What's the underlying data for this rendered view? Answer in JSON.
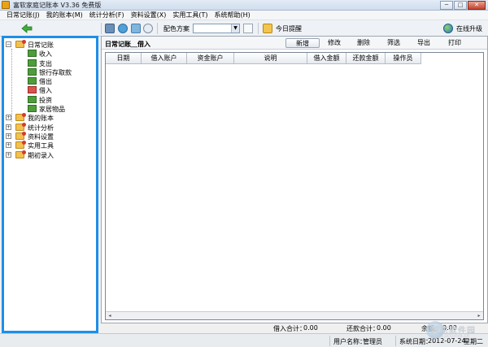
{
  "window": {
    "title": "富软家庭记账本 V3.36  免费版",
    "buttons": {
      "minimize": "─",
      "maximize": "□",
      "close": "✕"
    }
  },
  "menu": {
    "items": [
      {
        "label": "日常记账(J)"
      },
      {
        "label": "我的账本(M)"
      },
      {
        "label": "统计分析(F)"
      },
      {
        "label": "资料设置(X)"
      },
      {
        "label": "实用工具(T)"
      },
      {
        "label": "系统帮助(H)"
      }
    ]
  },
  "toolbar": {
    "color_scheme_label": "配色方案",
    "color_scheme_value": "",
    "combo_arrow": "▼",
    "reminder_label": "今日提醒",
    "upgrade_label": "在线升级"
  },
  "sidebar": {
    "groups": [
      {
        "label": "日常记账",
        "expanded": true,
        "expander": "−",
        "children": [
          {
            "label": "收入",
            "icon": "green"
          },
          {
            "label": "支出",
            "icon": "green"
          },
          {
            "label": "银行存取款",
            "icon": "green"
          },
          {
            "label": "借出",
            "icon": "green"
          },
          {
            "label": "借入",
            "icon": "red"
          },
          {
            "label": "投资",
            "icon": "green"
          },
          {
            "label": "家居物品",
            "icon": "green"
          }
        ]
      },
      {
        "label": "我的账本",
        "expanded": false,
        "expander": "+"
      },
      {
        "label": "统计分析",
        "expanded": false,
        "expander": "+"
      },
      {
        "label": "资料设置",
        "expanded": false,
        "expander": "+"
      },
      {
        "label": "实用工具",
        "expanded": false,
        "expander": "+"
      },
      {
        "label": "期初录入",
        "expanded": false,
        "expander": "+"
      }
    ]
  },
  "main": {
    "title": "日常记账＿借入",
    "actions": {
      "add": "新增",
      "edit": "修改",
      "delete": "删除",
      "filter": "筛选",
      "export": "导出",
      "print": "打印"
    },
    "columns": [
      "日期",
      "借入账户",
      "资金账户",
      "说明",
      "借入金额",
      "还款金额",
      "操作员"
    ],
    "rows": [],
    "scroll_left": "◂",
    "scroll_right": "▸"
  },
  "summary": {
    "borrow_total_label": "借入合计：",
    "borrow_total_value": "0.00",
    "repay_total_label": "还款合计：",
    "repay_total_value": "0.00",
    "balance_label": "余额：",
    "balance_value": "0.00"
  },
  "status": {
    "user_label": "用户名称：",
    "user_value": "管理员",
    "date_label": "系统日期：",
    "date_value": "2012-07-24",
    "weekday": "星期二"
  },
  "watermark": {
    "text": "河东软件园",
    "sub": "www.pc0359.cn"
  },
  "colors": {
    "sidebar_border": "#1e8ee8",
    "folder": "#f2c14e",
    "leaf": "#4f9d3a"
  }
}
